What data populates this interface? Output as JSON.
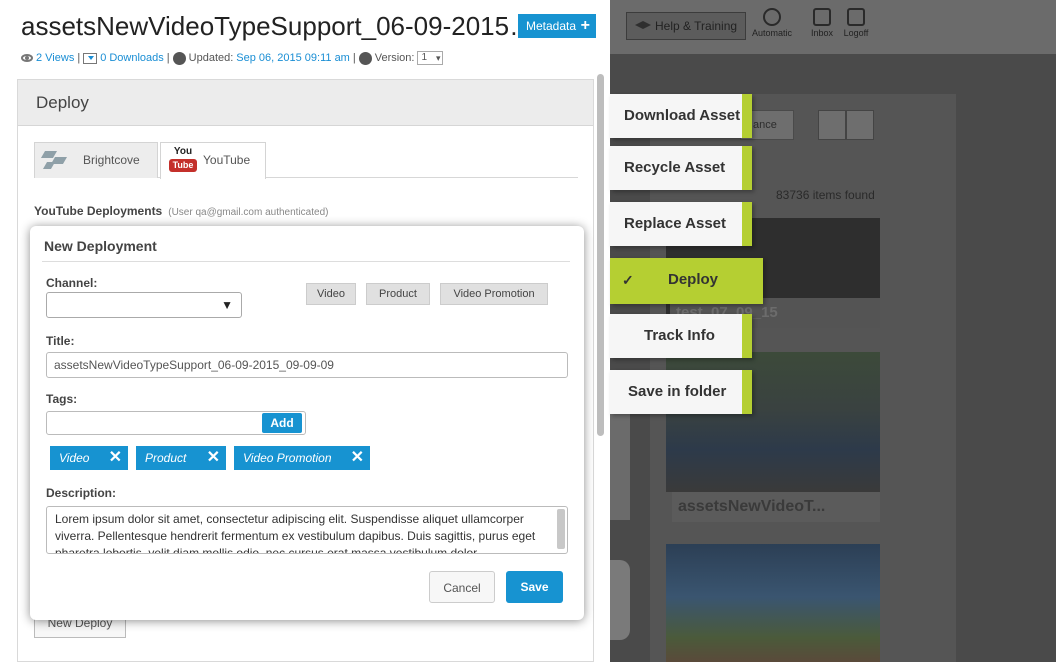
{
  "header": {
    "asset_title": "assetsNewVideoTypeSupport_06-09-2015…",
    "metadata_label": "Metadata",
    "views_count": "2 Views",
    "downloads_count": "0 Downloads",
    "updated_label": "Updated:",
    "updated_value": "Sep 06, 2015 09:11 am",
    "version_label": "Version:",
    "version_value": "1",
    "sep": "|"
  },
  "deploy_panel": {
    "title": "Deploy",
    "tabs": [
      {
        "label": "Brightcove",
        "icon": "brightcove-icon"
      },
      {
        "label": "YouTube",
        "icon": "youtube-icon",
        "icon_text_top": "You",
        "icon_text_bottom": "Tube"
      }
    ],
    "youtube_deployments_label": "YouTube Deployments",
    "youtube_auth_note": "(User qa@gmail.com authenticated)",
    "new_deploy_label": "New Deploy"
  },
  "modal": {
    "title": "New Deployment",
    "channel_label": "Channel:",
    "channel_value": "",
    "chips": [
      "Video",
      "Product",
      "Video Promotion"
    ],
    "title_label": "Title:",
    "title_value": "assetsNewVideoTypeSupport_06-09-2015_09-09-09",
    "tags_label": "Tags:",
    "tags_value": "",
    "add_label": "Add",
    "tags": [
      "Video",
      "Product",
      "Video Promotion"
    ],
    "description_label": "Description:",
    "description_value": "Lorem ipsum dolor sit amet, consectetur adipiscing elit. Suspendisse aliquet ullamcorper viverra. Pellentesque hendrerit fermentum ex vestibulum dapibus. Duis sagittis, purus eget pharetra lobortis, velit diam mollis odio, nec cursus erat massa vestibulum dolor.",
    "cancel_label": "Cancel",
    "save_label": "Save"
  },
  "action_menu": {
    "items": [
      {
        "label": "Download Asset",
        "active": false
      },
      {
        "label": "Recycle Asset",
        "active": false
      },
      {
        "label": "Replace Asset",
        "active": false
      },
      {
        "label": "Deploy",
        "active": true
      },
      {
        "label": "Track Info",
        "active": false
      },
      {
        "label": "Save in folder",
        "active": false
      }
    ],
    "accent_color": "#b5cf32"
  },
  "background_app": {
    "help_label": "Help & Training",
    "automatic_label": "Automatic",
    "inbox_label": "Inbox",
    "logoff_label": "Logoff",
    "search_partial": "ance",
    "items_found": "83736 items found",
    "thumb1_label": "test_07_09_15",
    "thumb2_label": "assetsNewVideoT..."
  },
  "colors": {
    "primary_blue": "#1793d1",
    "lime": "#b5cf32",
    "overlay": "#4a4a4a"
  }
}
